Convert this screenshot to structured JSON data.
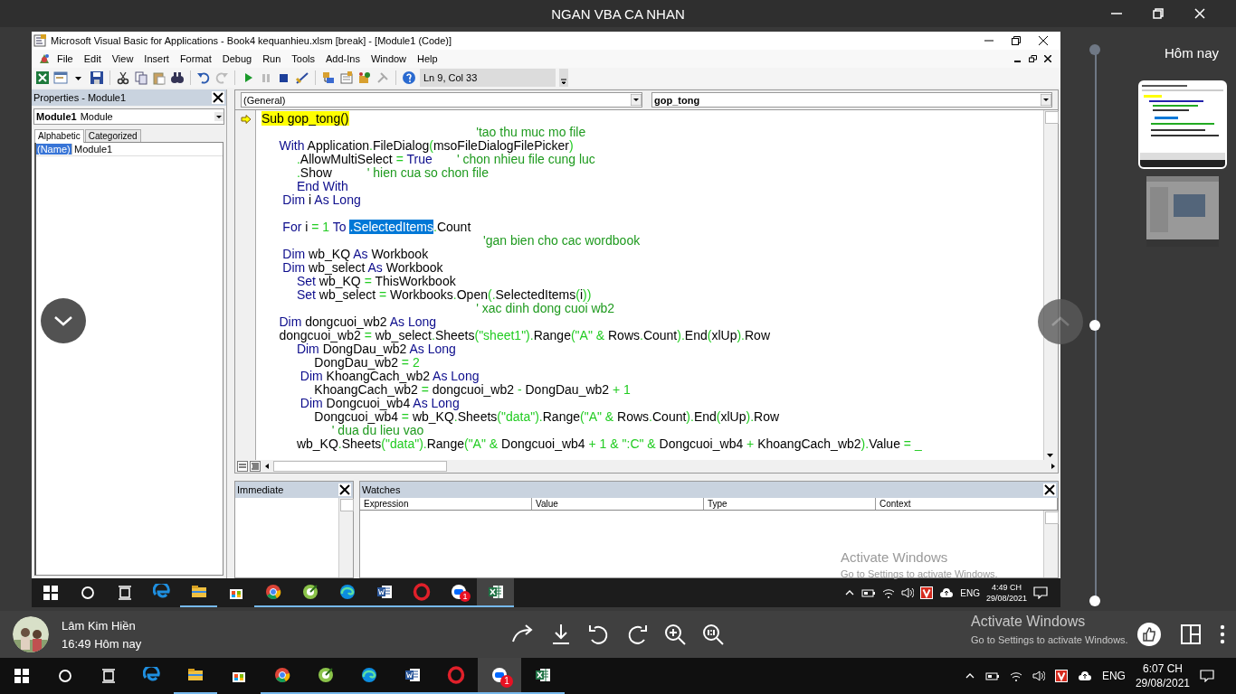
{
  "app_window": {
    "title": "NGAN VBA CA NHAN"
  },
  "vba": {
    "title": "Microsoft Visual Basic for Applications - Book4 kequanhieu.xlsm [break] - [Module1 (Code)]",
    "menu": [
      "File",
      "Edit",
      "View",
      "Insert",
      "Format",
      "Debug",
      "Run",
      "Tools",
      "Add-Ins",
      "Window",
      "Help"
    ],
    "cursor_position": "Ln 9, Col 33",
    "properties": {
      "title": "Properties - Module1",
      "object_name": "Module1",
      "object_type": "Module",
      "tabs": [
        {
          "label": "Alphabetic",
          "selected": true
        },
        {
          "label": "Categorized",
          "selected": false
        }
      ],
      "rows": [
        {
          "name": "(Name)",
          "value": "Module1",
          "selected": true
        }
      ]
    },
    "code": {
      "object": "(General)",
      "procedure": "gop_tong",
      "lines": [
        {
          "kind": "code",
          "current": true,
          "segments": [
            {
              "kind": "hl",
              "text": "Sub gop_tong()"
            }
          ]
        },
        {
          "kind": "code",
          "current": false,
          "segments": [
            {
              "kind": "cm",
              "text": "                                                             'tao thu muc mo file"
            }
          ]
        },
        {
          "kind": "code",
          "current": false,
          "segments": [
            {
              "kind": "kw",
              "text": "     With"
            },
            {
              "kind": "id",
              "text": " Application"
            },
            {
              "kind": "op",
              "text": "."
            },
            {
              "kind": "id",
              "text": "FileDialog"
            },
            {
              "kind": "op",
              "text": "("
            },
            {
              "kind": "id",
              "text": "msoFileDialogFilePicker"
            },
            {
              "kind": "op",
              "text": ")"
            }
          ]
        },
        {
          "kind": "code",
          "current": false,
          "segments": [
            {
              "kind": "op",
              "text": "          ."
            },
            {
              "kind": "id",
              "text": "AllowMultiSelect "
            },
            {
              "kind": "op",
              "text": "="
            },
            {
              "kind": "kw",
              "text": " True"
            },
            {
              "kind": "cm",
              "text": "       ' chon nhieu file cung luc"
            }
          ]
        },
        {
          "kind": "code",
          "current": false,
          "segments": [
            {
              "kind": "op",
              "text": "          ."
            },
            {
              "kind": "id",
              "text": "Show"
            },
            {
              "kind": "cm",
              "text": "          ' hien cua so chon file"
            }
          ]
        },
        {
          "kind": "code",
          "current": false,
          "segments": [
            {
              "kind": "kw",
              "text": "          End With"
            }
          ]
        },
        {
          "kind": "code",
          "current": false,
          "segments": [
            {
              "kind": "kw",
              "text": "      Dim"
            },
            {
              "kind": "id",
              "text": " i "
            },
            {
              "kind": "kw",
              "text": "As Long"
            }
          ]
        },
        {
          "kind": "blank",
          "current": false
        },
        {
          "kind": "code",
          "current": false,
          "segments": [
            {
              "kind": "kw",
              "text": "      For"
            },
            {
              "kind": "id",
              "text": " i "
            },
            {
              "kind": "op",
              "text": "="
            },
            {
              "kind": "op",
              "text": " 1"
            },
            {
              "kind": "kw",
              "text": " To "
            },
            {
              "kind": "sel",
              "text": ".SelectedItems"
            },
            {
              "kind": "op",
              "text": "."
            },
            {
              "kind": "id",
              "text": "Count"
            }
          ]
        },
        {
          "kind": "code",
          "current": false,
          "segments": [
            {
              "kind": "cm",
              "text": "                                                               'gan bien cho cac wordbook"
            }
          ]
        },
        {
          "kind": "code",
          "current": false,
          "segments": [
            {
              "kind": "kw",
              "text": "      Dim"
            },
            {
              "kind": "id",
              "text": " wb_KQ "
            },
            {
              "kind": "kw",
              "text": "As"
            },
            {
              "kind": "id",
              "text": " Workbook"
            }
          ]
        },
        {
          "kind": "code",
          "current": false,
          "segments": [
            {
              "kind": "kw",
              "text": "      Dim"
            },
            {
              "kind": "id",
              "text": " wb_select "
            },
            {
              "kind": "kw",
              "text": "As"
            },
            {
              "kind": "id",
              "text": " Workbook"
            }
          ]
        },
        {
          "kind": "code",
          "current": false,
          "segments": [
            {
              "kind": "kw",
              "text": "          Set"
            },
            {
              "kind": "id",
              "text": " wb_KQ "
            },
            {
              "kind": "op",
              "text": "="
            },
            {
              "kind": "id",
              "text": " ThisWorkbook"
            }
          ]
        },
        {
          "kind": "code",
          "current": false,
          "segments": [
            {
              "kind": "kw",
              "text": "          Set"
            },
            {
              "kind": "id",
              "text": " wb_select "
            },
            {
              "kind": "op",
              "text": "="
            },
            {
              "kind": "id",
              "text": " Workbooks"
            },
            {
              "kind": "op",
              "text": "."
            },
            {
              "kind": "id",
              "text": "Open"
            },
            {
              "kind": "op",
              "text": "(."
            },
            {
              "kind": "id",
              "text": "SelectedItems"
            },
            {
              "kind": "op",
              "text": "("
            },
            {
              "kind": "id",
              "text": "i"
            },
            {
              "kind": "op",
              "text": "))"
            }
          ]
        },
        {
          "kind": "code",
          "current": false,
          "segments": [
            {
              "kind": "cm",
              "text": "                                                             ' xac dinh dong cuoi wb2"
            }
          ]
        },
        {
          "kind": "code",
          "current": false,
          "segments": [
            {
              "kind": "kw",
              "text": "     Dim"
            },
            {
              "kind": "id",
              "text": " dongcuoi_wb2 "
            },
            {
              "kind": "kw",
              "text": "As Long"
            }
          ]
        },
        {
          "kind": "code",
          "current": false,
          "segments": [
            {
              "kind": "id",
              "text": "     dongcuoi_wb2 "
            },
            {
              "kind": "op",
              "text": "="
            },
            {
              "kind": "id",
              "text": " wb_select"
            },
            {
              "kind": "op",
              "text": "."
            },
            {
              "kind": "id",
              "text": "Sheets"
            },
            {
              "kind": "op",
              "text": "(\"sheet1\")."
            },
            {
              "kind": "id",
              "text": "Range"
            },
            {
              "kind": "op",
              "text": "(\"A\" &"
            },
            {
              "kind": "id",
              "text": " Rows"
            },
            {
              "kind": "op",
              "text": "."
            },
            {
              "kind": "id",
              "text": "Count"
            },
            {
              "kind": "op",
              "text": ")."
            },
            {
              "kind": "id",
              "text": "End"
            },
            {
              "kind": "op",
              "text": "("
            },
            {
              "kind": "id",
              "text": "xlUp"
            },
            {
              "kind": "op",
              "text": ")."
            },
            {
              "kind": "id",
              "text": "Row"
            }
          ]
        },
        {
          "kind": "code",
          "current": false,
          "segments": [
            {
              "kind": "kw",
              "text": "          Dim"
            },
            {
              "kind": "id",
              "text": " DongDau_wb2 "
            },
            {
              "kind": "kw",
              "text": "As Long"
            }
          ]
        },
        {
          "kind": "code",
          "current": false,
          "segments": [
            {
              "kind": "id",
              "text": "               DongDau_wb2 "
            },
            {
              "kind": "op",
              "text": "= 2"
            }
          ]
        },
        {
          "kind": "code",
          "current": false,
          "segments": [
            {
              "kind": "kw",
              "text": "           Dim"
            },
            {
              "kind": "id",
              "text": " KhoangCach_wb2 "
            },
            {
              "kind": "kw",
              "text": "As Long"
            }
          ]
        },
        {
          "kind": "code",
          "current": false,
          "segments": [
            {
              "kind": "id",
              "text": "               KhoangCach_wb2 "
            },
            {
              "kind": "op",
              "text": "="
            },
            {
              "kind": "id",
              "text": " dongcuoi_wb2 "
            },
            {
              "kind": "op",
              "text": "-"
            },
            {
              "kind": "id",
              "text": " DongDau_wb2 "
            },
            {
              "kind": "op",
              "text": "+ 1"
            }
          ]
        },
        {
          "kind": "code",
          "current": false,
          "segments": [
            {
              "kind": "kw",
              "text": "           Dim"
            },
            {
              "kind": "id",
              "text": " Dongcuoi_wb4 "
            },
            {
              "kind": "kw",
              "text": "As Long"
            }
          ]
        },
        {
          "kind": "code",
          "current": false,
          "segments": [
            {
              "kind": "id",
              "text": "               Dongcuoi_wb4 "
            },
            {
              "kind": "op",
              "text": "="
            },
            {
              "kind": "id",
              "text": " wb_KQ"
            },
            {
              "kind": "op",
              "text": "."
            },
            {
              "kind": "id",
              "text": "Sheets"
            },
            {
              "kind": "op",
              "text": "(\"data\")."
            },
            {
              "kind": "id",
              "text": "Range"
            },
            {
              "kind": "op",
              "text": "(\"A\" &"
            },
            {
              "kind": "id",
              "text": " Rows"
            },
            {
              "kind": "op",
              "text": "."
            },
            {
              "kind": "id",
              "text": "Count"
            },
            {
              "kind": "op",
              "text": ")."
            },
            {
              "kind": "id",
              "text": "End"
            },
            {
              "kind": "op",
              "text": "("
            },
            {
              "kind": "id",
              "text": "xlUp"
            },
            {
              "kind": "op",
              "text": ")."
            },
            {
              "kind": "id",
              "text": "Row"
            }
          ]
        },
        {
          "kind": "code",
          "current": false,
          "segments": [
            {
              "kind": "cm",
              "text": "                    ' dua du lieu vao"
            }
          ]
        },
        {
          "kind": "code",
          "current": false,
          "segments": [
            {
              "kind": "id",
              "text": "          wb_KQ"
            },
            {
              "kind": "op",
              "text": "."
            },
            {
              "kind": "id",
              "text": "Sheets"
            },
            {
              "kind": "op",
              "text": "(\"data\")."
            },
            {
              "kind": "id",
              "text": "Range"
            },
            {
              "kind": "op",
              "text": "(\"A\" &"
            },
            {
              "kind": "id",
              "text": " Dongcuoi_wb4 "
            },
            {
              "kind": "op",
              "text": "+ 1 & \":C\" &"
            },
            {
              "kind": "id",
              "text": " Dongcuoi_wb4 "
            },
            {
              "kind": "op",
              "text": "+"
            },
            {
              "kind": "id",
              "text": " KhoangCach_wb2"
            },
            {
              "kind": "op",
              "text": ")."
            },
            {
              "kind": "id",
              "text": "Value "
            },
            {
              "kind": "op",
              "text": "= _"
            }
          ]
        }
      ]
    },
    "immediate": {
      "title": "Immediate"
    },
    "watches": {
      "title": "Watches",
      "columns": [
        "Expression",
        "Value",
        "Type",
        "Context"
      ]
    },
    "activation": {
      "title": "Activate Windows",
      "message": "Go to Settings to activate Windows."
    },
    "taskbar": {
      "apps": [
        {
          "running": false,
          "active": false
        },
        {
          "running": true,
          "active": false
        },
        {
          "running": false,
          "active": false
        },
        {
          "running": true,
          "active": false
        },
        {
          "running": true,
          "active": false
        },
        {
          "running": true,
          "active": false
        },
        {
          "running": true,
          "active": false
        },
        {
          "running": true,
          "active": false
        },
        {
          "running": true,
          "active": false,
          "badge": "1"
        },
        {
          "running": true,
          "active": true
        }
      ],
      "language": "ENG",
      "time": "4:49 CH",
      "date": "29/08/2021"
    }
  },
  "timeline": {
    "label": "Hôm nay",
    "thumbnails": [
      {
        "selected": true
      },
      {
        "selected": false
      }
    ]
  },
  "sender": {
    "name": "Lâm Kim Hiền",
    "time": "16:49 Hôm nay"
  },
  "taskbar": {
    "apps": [
      {
        "running": false,
        "active": false
      },
      {
        "running": true,
        "active": false
      },
      {
        "running": false,
        "active": false
      },
      {
        "running": true,
        "active": false
      },
      {
        "running": true,
        "active": false
      },
      {
        "running": true,
        "active": false
      },
      {
        "running": true,
        "active": false
      },
      {
        "running": true,
        "active": false
      },
      {
        "running": true,
        "active": true,
        "badge": "1"
      },
      {
        "running": true,
        "active": false
      }
    ],
    "language": "ENG",
    "time": "6:07 CH",
    "date": "29/08/2021"
  },
  "activation": {
    "title": "Activate Windows",
    "message": "Go to Settings to activate Windows."
  }
}
